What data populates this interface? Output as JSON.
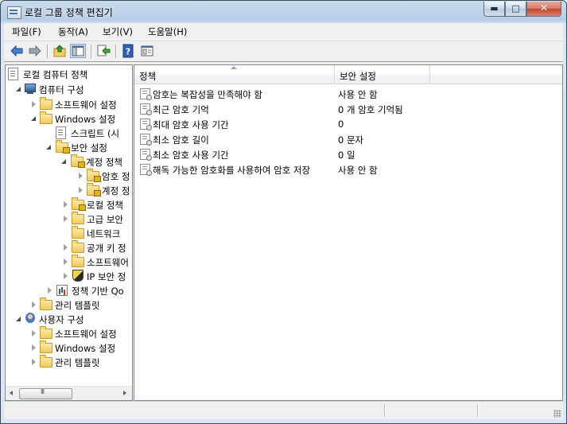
{
  "window": {
    "title": "로컬 그룹 정책 편집기",
    "buttons": {
      "minimize": "▬",
      "maximize": "□",
      "close": "✕"
    }
  },
  "menu": [
    "파일(F)",
    "동작(A)",
    "보기(V)",
    "도움말(H)"
  ],
  "toolbar": {
    "icons": [
      "back-arrow-icon",
      "forward-arrow-icon",
      "up-folder-icon",
      "show-hide-console-tree-icon",
      "export-list-icon",
      "help-icon",
      "properties-view-icon"
    ]
  },
  "tree": {
    "root": "로컬 컴퓨터 정책",
    "computer_config": "컴퓨터 구성",
    "software_settings": "소프트웨어 설정",
    "windows_settings": "Windows 설정",
    "scripts": "스크립트 (시",
    "security_settings": "보안 설정",
    "account_policies": "계정 정책",
    "password_policy": "암호 정",
    "account_lockout": "계정 정",
    "local_policies": "로컬 정책",
    "advanced_security": "고급 보안",
    "network": "네트워크",
    "public_key": "공개 키 정",
    "software_restriction": "소프트웨어",
    "ip_security": "IP 보안 정",
    "policy_qos": "정책 기반 Qo",
    "admin_templates": "관리 템플릿",
    "user_config": "사용자 구성",
    "user_software_settings": "소프트웨어 설정",
    "user_windows_settings": "Windows 설정",
    "user_admin_templates": "관리 템플릿",
    "scroll_thumb": "III"
  },
  "list": {
    "columns": [
      "정책",
      "보안 설정"
    ],
    "rows": [
      {
        "name": "암호는 복잡성을 만족해야 함",
        "value": "사용 안 함"
      },
      {
        "name": "최근 암호 기억",
        "value": "0 개 암호 기억됨"
      },
      {
        "name": "최대 암호 사용 기간",
        "value": "0"
      },
      {
        "name": "최소 암호 길이",
        "value": "0 문자"
      },
      {
        "name": "최소 암호 사용 기간",
        "value": "0 일"
      },
      {
        "name": "해독 가능한 암호화를 사용하여 암호 저장",
        "value": "사용 안 함"
      }
    ]
  }
}
